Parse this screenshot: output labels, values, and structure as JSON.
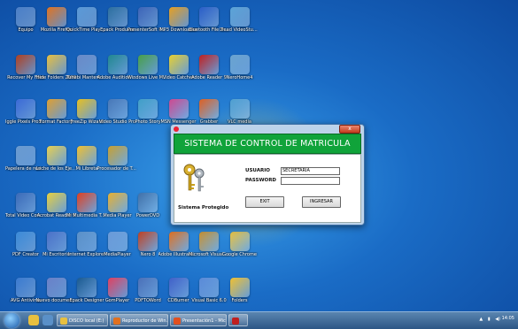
{
  "desktop_icons": [
    {
      "label": "Equipo",
      "color": "#4a7fc8"
    },
    {
      "label": "Mozilla Firefox",
      "color": "#e2731f"
    },
    {
      "label": "QuickTime Player 7",
      "color": "#5a9ad8"
    },
    {
      "label": "Epack Producer",
      "color": "#2c6fa0"
    },
    {
      "label": "PresenterSoft PowerVideoMa...",
      "color": "#3c64b8"
    },
    {
      "label": "MP3 Downloader",
      "color": "#e8a020"
    },
    {
      "label": "Bluetooth File Transfer Wizard",
      "color": "#2a5ec8"
    },
    {
      "label": "Ulead VideoStudio ...",
      "color": "#5ba4d8"
    },
    {
      "label": "Recover My Files",
      "color": "#b04020"
    },
    {
      "label": "Hide Folders 2009",
      "color": "#e8c040"
    },
    {
      "label": "Tunebi Mantenimien...",
      "color": "#6a8ac8"
    },
    {
      "label": "Adobe Audition 3.0",
      "color": "#208890"
    },
    {
      "label": "Windows Live Messenger",
      "color": "#48a048"
    },
    {
      "label": "Video Catcher",
      "color": "#e8d030"
    },
    {
      "label": "Adobe Reader 9",
      "color": "#c02020"
    },
    {
      "label": "NeroHome4",
      "color": "#6aa4d0"
    },
    {
      "label": "Iggle Pixels ProShow Gold",
      "color": "#3a6ad8"
    },
    {
      "label": "Format Factory",
      "color": "#e0a030"
    },
    {
      "label": "FreeZip Wizard",
      "color": "#e8c020"
    },
    {
      "label": "Video Studio Pro",
      "color": "#4878b8"
    },
    {
      "label": "Photo Story",
      "color": "#40a0c8"
    },
    {
      "label": "MSN Messenger",
      "color": "#d04890"
    },
    {
      "label": "Grabber",
      "color": "#e06020"
    },
    {
      "label": "VLC media",
      "color": "#50a0d0"
    },
    {
      "label": "Papelera de reciclaje",
      "color": "#6a9ad0"
    },
    {
      "label": "Leche de los Ejercicios",
      "color": "#e8d050"
    },
    {
      "label": "Mi Libreta",
      "color": "#f0c030"
    },
    {
      "label": "Procesador de Textos",
      "color": "#c8a030"
    },
    {
      "label": "Total Video Converter",
      "color": "#3a6ab8"
    },
    {
      "label": "Acrobat Reader 9",
      "color": "#e8d040"
    },
    {
      "label": "Mi Multimedia Toolbox",
      "color": "#e04020"
    },
    {
      "label": "Media Player",
      "color": "#e8b030"
    },
    {
      "label": "PowerDVD",
      "color": "#4070a8"
    },
    {
      "label": "PDF Creator",
      "color": "#3a8ad8"
    },
    {
      "label": "Mi Escritorio",
      "color": "#4a70c8"
    },
    {
      "label": "Internet Explorer",
      "color": "#5a90c8"
    },
    {
      "label": "MediaPlayer",
      "color": "#6a9ad8"
    },
    {
      "label": "Nero 8",
      "color": "#c04020"
    },
    {
      "label": "Adobe Illustrator CS3",
      "color": "#e07020"
    },
    {
      "label": "Microsoft Visual Studio 6.0",
      "color": "#c89030"
    },
    {
      "label": "Google Chrome",
      "color": "#e8c040"
    },
    {
      "label": "AVG Antivirus",
      "color": "#3a7ad0"
    },
    {
      "label": "Nuevo documento de Word",
      "color": "#6a80c8"
    },
    {
      "label": "Epack Designer",
      "color": "#1a5a90"
    },
    {
      "label": "GomPlayer",
      "color": "#e04060"
    },
    {
      "label": "PDFTOWord",
      "color": "#4a70b8"
    },
    {
      "label": "CDBurner",
      "color": "#4060c8"
    },
    {
      "label": "Visual Basic 6.0",
      "color": "#5a8ad8"
    },
    {
      "label": "Folders",
      "color": "#f0c030"
    }
  ],
  "login_window": {
    "title": "SISTEMA DE CONTROL DE MATRICULA",
    "close": "x",
    "usuario_label": "USUARIO",
    "usuario_value": "SECRETARIA",
    "password_label": "PASSWORD",
    "password_value": "",
    "protected_label": "Sistema Protegido",
    "exit_button": "EXIT",
    "enter_button": "INGRESAR",
    "header_color": "#10a33a"
  },
  "taskbar": {
    "buttons": [
      {
        "label": "DISCO local (E:)",
        "color": "#e8c040"
      },
      {
        "label": "Reproductor de Win...",
        "color": "#e07020"
      },
      {
        "label": "Presentación1 - Micr...",
        "color": "#e05020"
      },
      {
        "label": "",
        "color": "#c02020"
      }
    ],
    "tray": [
      "▲",
      "▮",
      "◀)"
    ],
    "clock": "14:05"
  }
}
